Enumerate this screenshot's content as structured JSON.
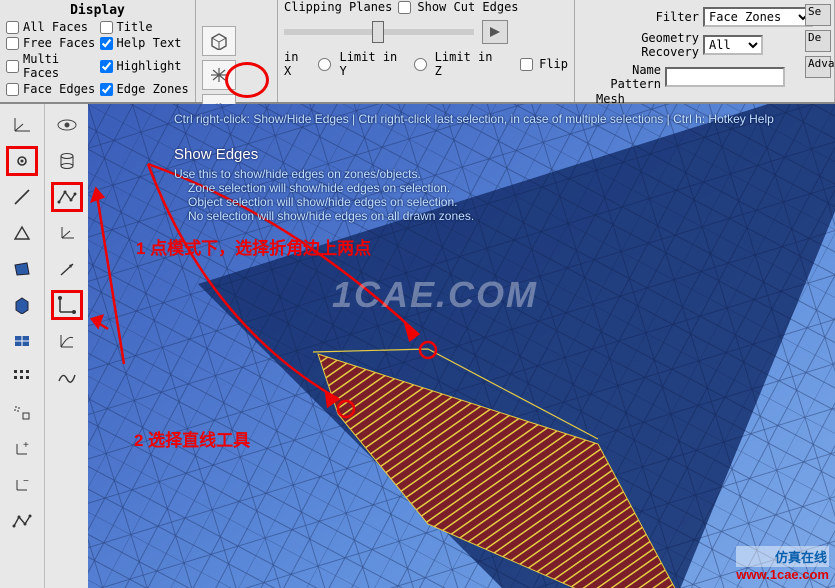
{
  "display": {
    "title": "Display",
    "checks": [
      {
        "label": "All Faces",
        "checked": false
      },
      {
        "label": "Title",
        "checked": false
      },
      {
        "label": "Free Faces",
        "checked": false
      },
      {
        "label": "Help Text",
        "checked": true
      },
      {
        "label": "Multi Faces",
        "checked": false
      },
      {
        "label": "Highlight",
        "checked": true
      },
      {
        "label": "Face Edges",
        "checked": false
      },
      {
        "label": "Edge Zones",
        "checked": true
      }
    ]
  },
  "clipping": {
    "title": "Clipping Planes",
    "showCut": "Show Cut Edges",
    "limitX": "in X",
    "limitY": "Limit in Y",
    "limitZ": "Limit in Z",
    "flip": "Flip"
  },
  "filter": {
    "label": "Filter",
    "value": "Face Zones",
    "geomLabel": "Geometry Recovery",
    "geomValue": "All",
    "nameLabel": "Name Pattern",
    "nameValue": ""
  },
  "buttons": {
    "se": "Se",
    "des": "De",
    "adv": "Adva"
  },
  "meshLabel": "Mesh",
  "help": {
    "top": "Ctrl right-click: Show/Hide Edges | Ctrl right-click last selection, in case of multiple selections | Ctrl h: Hotkey Help",
    "title": "Show Edges",
    "l1": "Use this to show/hide edges on zones/objects.",
    "l2": "Zone selection will show/hide edges on selection.",
    "l3": "Object selection will show/hide edges on selection.",
    "l4": "No selection will show/hide edges on all drawn zones."
  },
  "anno1": "1 点模式下，选择折角边上两点",
  "anno2": "2 选择直线工具",
  "watermark": "1CAE.COM",
  "corner": {
    "line1": "仿真在线",
    "line2": "www.1cae.com"
  }
}
